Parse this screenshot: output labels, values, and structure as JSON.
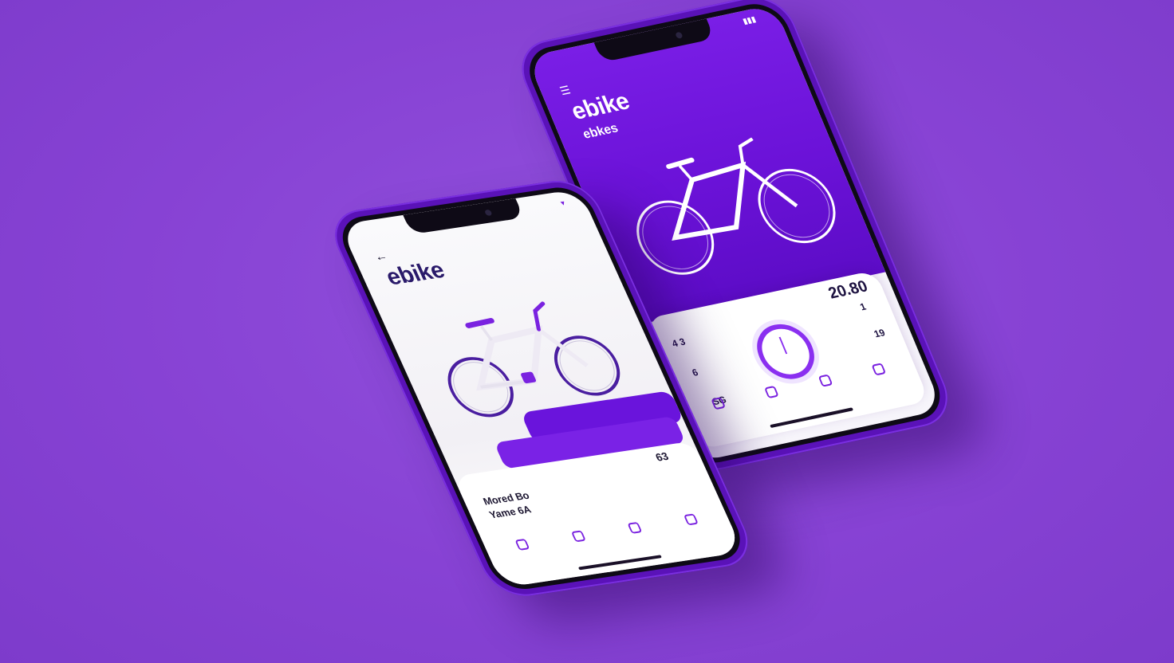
{
  "back_phone": {
    "status_time": "",
    "brand": "ebike",
    "subtitle": "ebkes",
    "description": "",
    "caption": "",
    "price": "20.80",
    "stats": [
      {
        "value": "4 3",
        "label": ""
      },
      {
        "value": "6",
        "label": ""
      },
      {
        "value": "SG",
        "label": ""
      },
      {
        "value": "1",
        "label": ""
      },
      {
        "value": "19",
        "label": ""
      }
    ],
    "nav": [
      {
        "icon": "home-icon",
        "label": ""
      },
      {
        "icon": "bike-icon",
        "label": ""
      },
      {
        "icon": "map-icon",
        "label": ""
      },
      {
        "icon": "profile-icon",
        "label": ""
      }
    ]
  },
  "front_phone": {
    "status_time": "",
    "brand": "ebike",
    "description": "",
    "cta_label": "",
    "sheet_count": "63",
    "title_line1": "Mored Bo",
    "title_line2": "Yame 6A",
    "meta": "",
    "nav": [
      {
        "icon": "home-icon",
        "label": ""
      },
      {
        "icon": "ride-icon",
        "label": ""
      },
      {
        "icon": "wallet-icon",
        "label": ""
      },
      {
        "icon": "profile-icon",
        "label": ""
      }
    ]
  },
  "colors": {
    "background": "#8a45d6",
    "accent": "#6a14dc",
    "dark_text": "#1b1530"
  }
}
